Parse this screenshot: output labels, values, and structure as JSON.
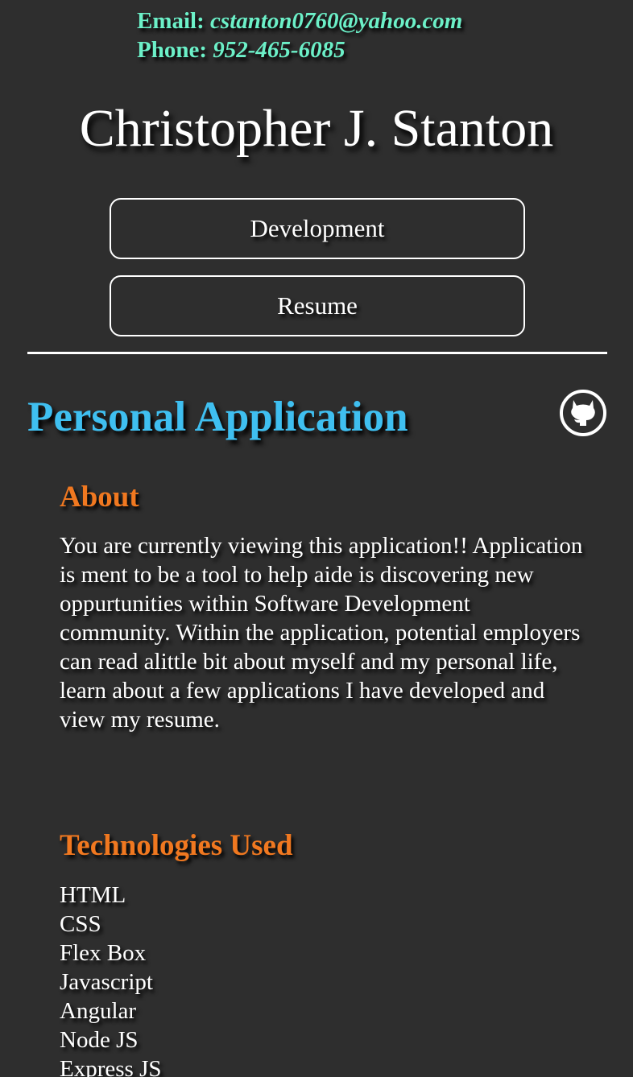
{
  "contact": {
    "email_label": "Email:",
    "email_value": "cstanton0760@yahoo.com",
    "phone_label": "Phone:",
    "phone_value": "952-465-6085"
  },
  "header": {
    "name": "Christopher J. Stanton"
  },
  "nav": {
    "development_label": "Development",
    "resume_label": "Resume"
  },
  "project": {
    "title": "Personal Application",
    "github_icon": "github-icon",
    "about_heading": "About",
    "about_text": "You are currently viewing this application!! Application is ment to be a tool to help aide is discovering new oppurtunities within Software Development community. Within the application, potential employers can read alittle bit about myself and my personal life, learn about a few applications I have developed and view my resume.",
    "tech_heading": "Technologies Used",
    "technologies": [
      "HTML",
      "CSS",
      "Flex Box",
      "Javascript",
      "Angular",
      "Node JS",
      "Express JS"
    ]
  },
  "colors": {
    "background": "#2e2e2e",
    "contact": "#6cf0c8",
    "project_title": "#3fbff0",
    "section_heading": "#f07820",
    "text": "#ffffff"
  }
}
